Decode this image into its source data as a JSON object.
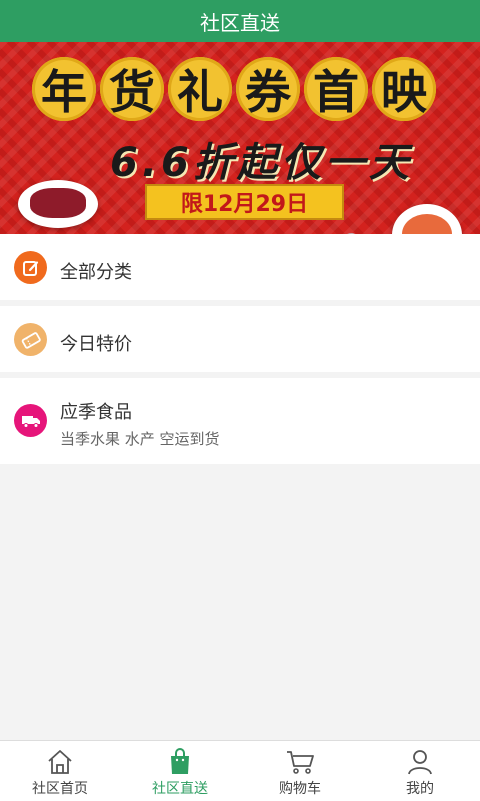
{
  "header": {
    "title": "社区直送"
  },
  "banner": {
    "title_chars": [
      "年",
      "货",
      "礼",
      "券",
      "首",
      "映"
    ],
    "subtitle": "6.6折起仅一天",
    "limit_text": "限12月29日",
    "page_index": 0,
    "page_count": 2
  },
  "menu": {
    "items": [
      {
        "label": "全部分类",
        "icon": "edit-icon",
        "color": "#f06a1d"
      },
      {
        "label": "今日特价",
        "icon": "ticket-icon",
        "color": "#f0b36a"
      },
      {
        "label": "应季食品",
        "desc": "当季水果 水产 空运到货",
        "icon": "truck-icon",
        "color": "#e6157a"
      }
    ]
  },
  "tabbar": {
    "tabs": [
      {
        "label": "社区首页",
        "icon": "home-icon"
      },
      {
        "label": "社区直送",
        "icon": "shopping-bag-icon",
        "active": true
      },
      {
        "label": "购物车",
        "icon": "cart-icon"
      },
      {
        "label": "我的",
        "icon": "user-icon"
      }
    ]
  },
  "colors": {
    "brand_green": "#2e9e62",
    "banner_red": "#d3221e",
    "banner_gold": "#f2c230"
  }
}
